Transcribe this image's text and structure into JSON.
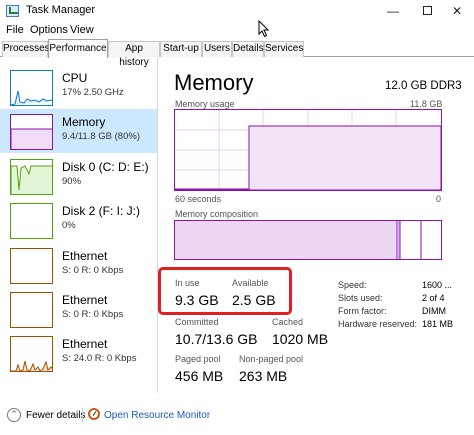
{
  "window": {
    "title": "Task Manager",
    "min_glyph": "—",
    "close_glyph": "✕"
  },
  "menu": [
    "File",
    "Options",
    "View"
  ],
  "tabs": [
    "Processes",
    "Performance",
    "App history",
    "Start-up",
    "Users",
    "Details",
    "Services"
  ],
  "sidebar": [
    {
      "name": "CPU",
      "sub": "17% 2.50 GHz",
      "kind": "cpu"
    },
    {
      "name": "Memory",
      "sub": "9.4/11.8 GB (80%)",
      "kind": "mem"
    },
    {
      "name": "Disk 0 (C: D: E:)",
      "sub": "90%",
      "kind": "disk"
    },
    {
      "name": "Disk 2 (F: I: J:)",
      "sub": "0%",
      "kind": "disk"
    },
    {
      "name": "Ethernet",
      "sub": "S: 0 R: 0 Kbps",
      "kind": "eth"
    },
    {
      "name": "Ethernet",
      "sub": "S: 0 R: 0 Kbps",
      "kind": "eth"
    },
    {
      "name": "Ethernet",
      "sub": "S: 24.0 R: 0 Kbps",
      "kind": "eth"
    }
  ],
  "main": {
    "title": "Memory",
    "spec": "12.0 GB DDR3",
    "usage_label": "Memory usage",
    "usage_max": "11.8 GB",
    "time_left": "60 seconds",
    "time_right": "0",
    "composition_label": "Memory composition",
    "usage_fraction_current": 0.8
  },
  "stats": {
    "in_use_label": "In use",
    "in_use": "9.3 GB",
    "available_label": "Available",
    "available": "2.5 GB",
    "committed_label": "Committed",
    "committed": "10.7/13.6 GB",
    "cached_label": "Cached",
    "cached": "1020 MB",
    "paged_label": "Paged pool",
    "paged": "456 MB",
    "nonpaged_label": "Non-paged pool",
    "nonpaged": "263 MB"
  },
  "details": [
    {
      "label": "Speed:",
      "value": "1600 ..."
    },
    {
      "label": "Slots used:",
      "value": "2 of 4"
    },
    {
      "label": "Form factor:",
      "value": "DIMM"
    },
    {
      "label": "Hardware reserved:",
      "value": "181 MB"
    }
  ],
  "footer": {
    "fewer": "Fewer details",
    "monitor": "Open Resource Monitor"
  },
  "colors": {
    "memory": "#8b12ae",
    "cpu": "#117dbb",
    "disk": "#4da60c",
    "ethernet": "#a74f01",
    "highlight": "#e02020",
    "link": "#1a5ac6",
    "selected": "#cce8ff"
  }
}
